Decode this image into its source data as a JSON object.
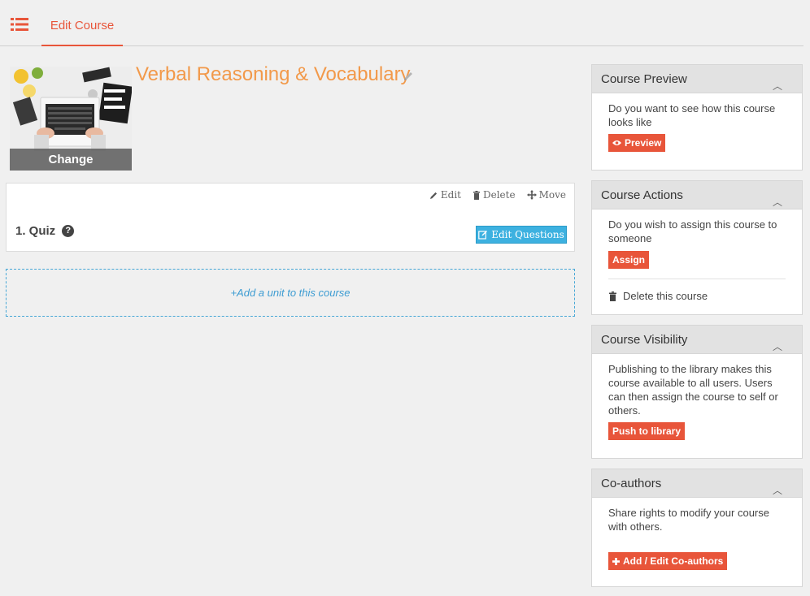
{
  "nav": {
    "menu_icon": "list-icon",
    "active_tab": "Edit Course"
  },
  "course": {
    "title": "Verbal Reasoning & Vocabulary",
    "image_change_label": "Change"
  },
  "unit": {
    "actions": {
      "edit": "Edit",
      "delete": "Delete",
      "move": "Move"
    },
    "name": "1. Quiz",
    "edit_questions_label": "Edit Questions"
  },
  "add_unit_label": "+Add a unit to this course",
  "panels": {
    "preview": {
      "title": "Course Preview",
      "text": "Do you want to see how this course looks like",
      "button": "Preview"
    },
    "actions": {
      "title": "Course Actions",
      "text": "Do you wish to assign this course to someone",
      "button": "Assign",
      "delete_label": "Delete this course"
    },
    "visibility": {
      "title": "Course Visibility",
      "text": "Publishing to the library makes this course available to all users. Users can then assign the course to self or others.",
      "button": "Push to library"
    },
    "coauthors": {
      "title": "Co-authors",
      "text": "Share rights to modify your course with others.",
      "button": "Add / Edit Co-authors"
    }
  },
  "colors": {
    "accent": "#e8553a",
    "title_orange": "#f2994a",
    "link_blue": "#3d9cd2",
    "button_blue": "#3db1e0"
  }
}
